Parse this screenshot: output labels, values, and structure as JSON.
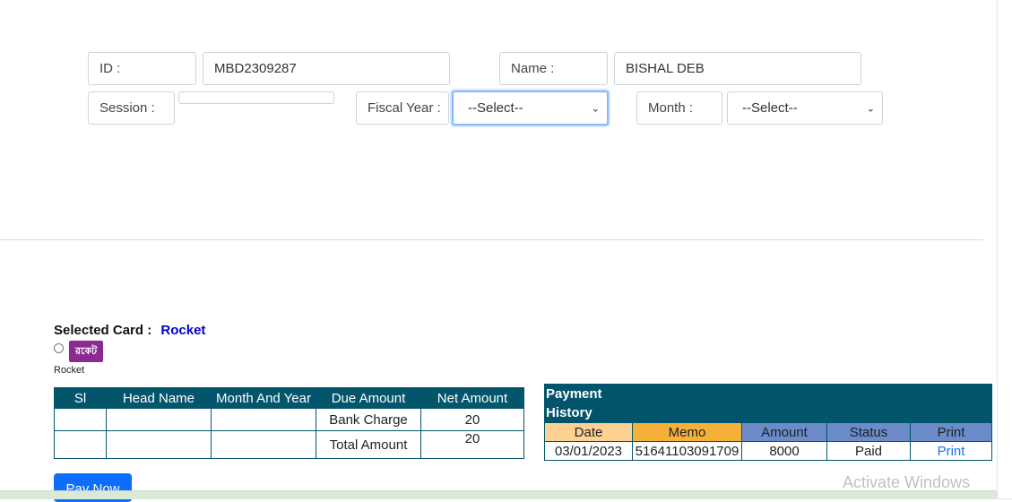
{
  "form": {
    "id_label": "ID :",
    "id_value": "MBD2309287",
    "name_label": "Name :",
    "name_value": "BISHAL DEB",
    "session_label": "Session :",
    "fiscal_year_label": "Fiscal Year :",
    "fiscal_year_selected": "--Select--",
    "month_label": "Month :",
    "month_selected": "--Select--"
  },
  "payment": {
    "selected_card_label": "Selected Card :",
    "selected_card_value": "Rocket",
    "card_name": "Rocket",
    "logo_text": "রকেট"
  },
  "due_table": {
    "headers": [
      "Sl",
      "Head Name",
      "Month And Year",
      "Due Amount",
      "Net Amount"
    ],
    "bank_charge_label": "Bank Charge",
    "bank_charge_value": "20",
    "total_amount_label": "Total Amount",
    "total_amount_value": "20"
  },
  "history": {
    "title": "Payment History",
    "headers": [
      "Date",
      "Memo",
      "Amount",
      "Status",
      "Print"
    ],
    "header_colors": [
      "#fdd093",
      "#f5b03a",
      "#6b8bc9",
      "#6b8bc9",
      "#6b8bc9"
    ],
    "row": {
      "date": "03/01/2023",
      "memo": "51641103091709",
      "amount": "8000",
      "status": "Paid",
      "print": "Print"
    }
  },
  "pay_button": "Pay Now",
  "watermark": "Activate Windows"
}
